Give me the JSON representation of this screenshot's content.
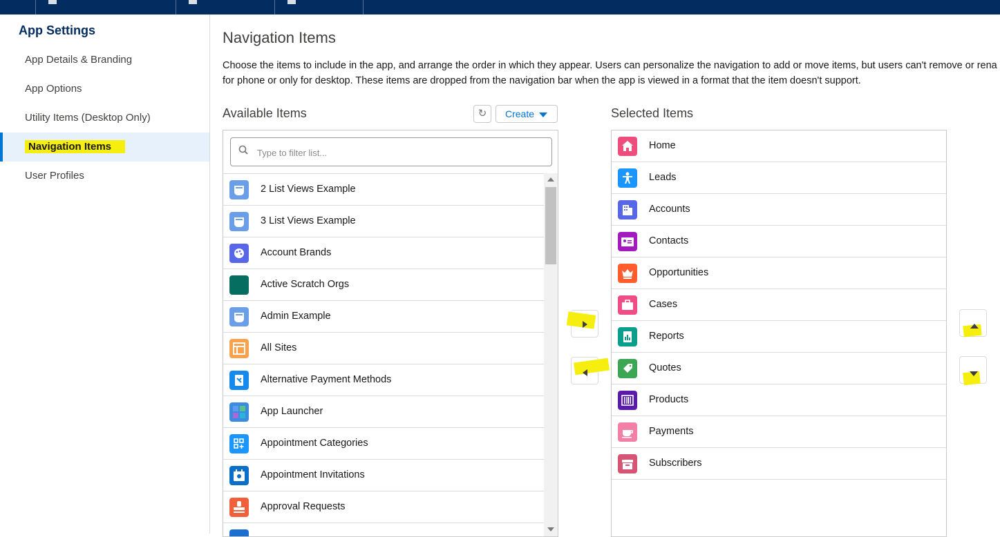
{
  "sidebar": {
    "title": "App Settings",
    "items": [
      {
        "label": "App Details & Branding"
      },
      {
        "label": "App Options"
      },
      {
        "label": "Utility Items (Desktop Only)"
      },
      {
        "label": "Navigation Items",
        "active": true
      },
      {
        "label": "User Profiles"
      }
    ]
  },
  "main": {
    "title": "Navigation Items",
    "description_line1": "Choose the items to include in the app, and arrange the order in which they appear. Users can personalize the navigation to add or move items, but users can't remove or rena",
    "description_line2": "for phone or only for desktop. These items are dropped from the navigation bar when the app is viewed in a format that the item doesn't support."
  },
  "available": {
    "label": "Available Items",
    "create_label": "Create",
    "filter_placeholder": "Type to filter list...",
    "items": [
      {
        "label": "2 List Views Example",
        "icon": "custom-object-icon",
        "color": "#6b9ee8"
      },
      {
        "label": "3 List Views Example",
        "icon": "custom-object-icon",
        "color": "#6b9ee8"
      },
      {
        "label": "Account Brands",
        "icon": "palette-icon",
        "color": "#5867e8"
      },
      {
        "label": "Active Scratch Orgs",
        "icon": "blank-icon",
        "color": "#066e60"
      },
      {
        "label": "Admin Example",
        "icon": "custom-object-icon",
        "color": "#6b9ee8"
      },
      {
        "label": "All Sites",
        "icon": "layout-icon",
        "color": "#f9a24b"
      },
      {
        "label": "Alternative Payment Methods",
        "icon": "payment-method-icon",
        "color": "#1589ee"
      },
      {
        "label": "App Launcher",
        "icon": "app-launcher-icon",
        "color": "#3b8bde"
      },
      {
        "label": "Appointment Categories",
        "icon": "appointment-categories-icon",
        "color": "#1b96ff"
      },
      {
        "label": "Appointment Invitations",
        "icon": "appointment-invitation-icon",
        "color": "#0b6ec9"
      },
      {
        "label": "Approval Requests",
        "icon": "approval-icon",
        "color": "#f2603b"
      },
      {
        "label": "",
        "icon": "partial-icon",
        "color": "#1b6fd1"
      }
    ]
  },
  "selected": {
    "label": "Selected Items",
    "items": [
      {
        "label": "Home",
        "icon": "home-icon",
        "color": "#ef4d7c"
      },
      {
        "label": "Leads",
        "icon": "lead-icon",
        "color": "#1b96ff"
      },
      {
        "label": "Accounts",
        "icon": "account-icon",
        "color": "#5867e8"
      },
      {
        "label": "Contacts",
        "icon": "contact-icon",
        "color": "#a21ac0"
      },
      {
        "label": "Opportunities",
        "icon": "opportunity-icon",
        "color": "#ff5d2d"
      },
      {
        "label": "Cases",
        "icon": "case-icon",
        "color": "#f04d86"
      },
      {
        "label": "Reports",
        "icon": "report-icon",
        "color": "#0b9e8c"
      },
      {
        "label": "Quotes",
        "icon": "quote-icon",
        "color": "#3ba755"
      },
      {
        "label": "Products",
        "icon": "product-icon",
        "color": "#5a1ba9"
      },
      {
        "label": "Payments",
        "icon": "payment-icon",
        "color": "#f27fa6"
      },
      {
        "label": "Subscribers",
        "icon": "subscriber-icon",
        "color": "#d85475"
      }
    ]
  }
}
